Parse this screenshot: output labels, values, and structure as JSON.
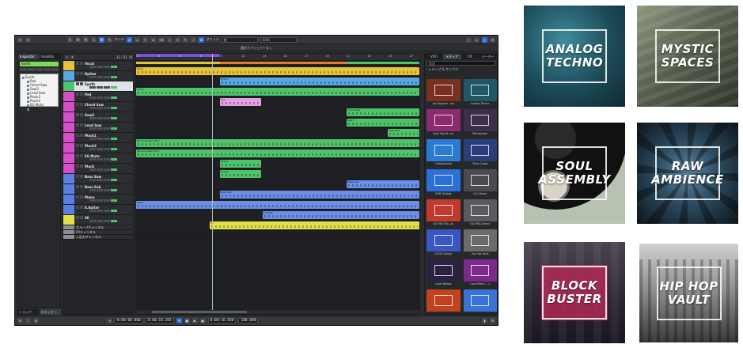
{
  "daw": {
    "toolbar": {
      "tools": [
        "W",
        "A"
      ],
      "touch_mode": "タッチ",
      "grid_label": "グリッド",
      "grid_value": "1/16",
      "bar_label": "拍"
    },
    "info_line": "選択オブジェクトなし",
    "inspector": {
      "tabs": [
        "Inspector",
        "Visibility"
      ],
      "track_name": "Synth",
      "folder_root": "Synth",
      "folder_items": [
        "Pad",
        "Chord Saw",
        "Saw3",
        "Lead Saw",
        "Pluck1",
        "Pluck2",
        "EG Mute",
        "Pluck"
      ]
    },
    "left_bottom_tabs": [
      "トラック",
      "エディター"
    ],
    "track_column": {
      "count": "31 / 31",
      "marker_label": "マーカー"
    },
    "tracks": [
      {
        "name": "Vocal",
        "color": "#e6c238"
      },
      {
        "name": "Rythm",
        "color": "#56a9e3"
      },
      {
        "name": "Synth",
        "color": "#4fc36a",
        "selected": true
      },
      {
        "name": "Pad",
        "color": "#d64fc9"
      },
      {
        "name": "Chord Saw",
        "color": "#d64fc9"
      },
      {
        "name": "Saw3",
        "color": "#d64fc9"
      },
      {
        "name": "Lead Saw",
        "color": "#d64fc9"
      },
      {
        "name": "Pluck1",
        "color": "#d64fc9"
      },
      {
        "name": "Pluck2",
        "color": "#d64fc9"
      },
      {
        "name": "EG Mute",
        "color": "#d64fc9"
      },
      {
        "name": "Pluck",
        "color": "#d64fc9"
      },
      {
        "name": "Bass Saw",
        "color": "#5b7fe0"
      },
      {
        "name": "Bass Sub",
        "color": "#5b7fe0"
      },
      {
        "name": "Piano",
        "color": "#5b7fe0"
      },
      {
        "name": "E.Guitar",
        "color": "#5b7fe0"
      },
      {
        "name": "SE",
        "color": "#e3e045"
      },
      {
        "name": "グループチャンネル",
        "color": "#8a8d92"
      },
      {
        "name": "FXチャンネル",
        "color": "#8a8d92"
      },
      {
        "name": "入出力チャンネル",
        "color": "#8a8d92"
      }
    ],
    "ruler_numbers": [
      "1",
      "3",
      "5",
      "7",
      "9",
      "11",
      "13",
      "15",
      "17",
      "19",
      "21",
      "23",
      "25",
      "27"
    ],
    "parts": {
      "vocal": "Vocal",
      "rythm": "Rythm",
      "synth": "Synth",
      "pad": "Pad",
      "chord_saw": "Chord Saw",
      "saw3": "Saw3",
      "lead_saw": "Lead Saw",
      "pluck1": "Wz Loo Sustin 86 Y",
      "pluck2": "Wz Loo Sustin 86 Y",
      "eg_mute": "Pluck1",
      "pluck": "Pluck2",
      "bass_saw": "Bass Saw",
      "bass_sub": "Bass Sub",
      "piano": "Piano",
      "e_guitar": "E.Guitar",
      "se": "SE"
    },
    "mediabay": {
      "tabs": [
        "VSTi",
        "メディア",
        "CR",
        "メーター"
      ],
      "search_placeholder": "検索",
      "breadcrumb": "ループ & サンプル",
      "items": [
        {
          "label": "4st Signatur...me",
          "color": "#7a3020"
        },
        {
          "label": "Analog Techno",
          "color": "#1f5866"
        },
        {
          "label": "Rock Pop To...es",
          "color": "#8c2b6e"
        },
        {
          "label": "Blockbuster",
          "color": "#3b2f4a"
        },
        {
          "label": "Caleidoscope",
          "color": "#2a7bd3"
        },
        {
          "label": "Drum Loops",
          "color": "#2a3f7a"
        },
        {
          "label": "EDM Toolbox",
          "color": "#2c6fd8"
        },
        {
          "label": "GA Library",
          "color": "#4a4a4f"
        },
        {
          "label": "GA ONE Sha...ss",
          "color": "#c23a2f"
        },
        {
          "label": "GA ONE Library",
          "color": "#5a5a60"
        },
        {
          "label": "GA 5E Library",
          "color": "#3a55c6"
        },
        {
          "label": "Hip Hop Vault",
          "color": "#6b6b6b"
        },
        {
          "label": "Laser Beams",
          "color": "#2b2140"
        },
        {
          "label": "Loop Mash L...y",
          "color": "#7a2a88"
        },
        {
          "label": "",
          "color": "#c2411f"
        },
        {
          "label": "",
          "color": "#3a73d8"
        }
      ]
    },
    "transport": {
      "time_start": "0:00:00.000",
      "time_end": "0:00:18.283",
      "position": "0:00:16.688",
      "tempo": "100.000"
    }
  },
  "tiles": [
    {
      "title_line1": "ANALOG",
      "title_line2": "TECHNO"
    },
    {
      "title_line1": "MYSTIC",
      "title_line2": "SPACES"
    },
    {
      "title_line1": "SOUL",
      "title_line2": "ASSEMBLY"
    },
    {
      "title_line1": "RAW",
      "title_line2": "AMBIENCE"
    },
    {
      "title_line1": "BLOCK",
      "title_line2": "BUSTER"
    },
    {
      "title_line1": "HIP HOP",
      "title_line2": "VAULT"
    }
  ]
}
